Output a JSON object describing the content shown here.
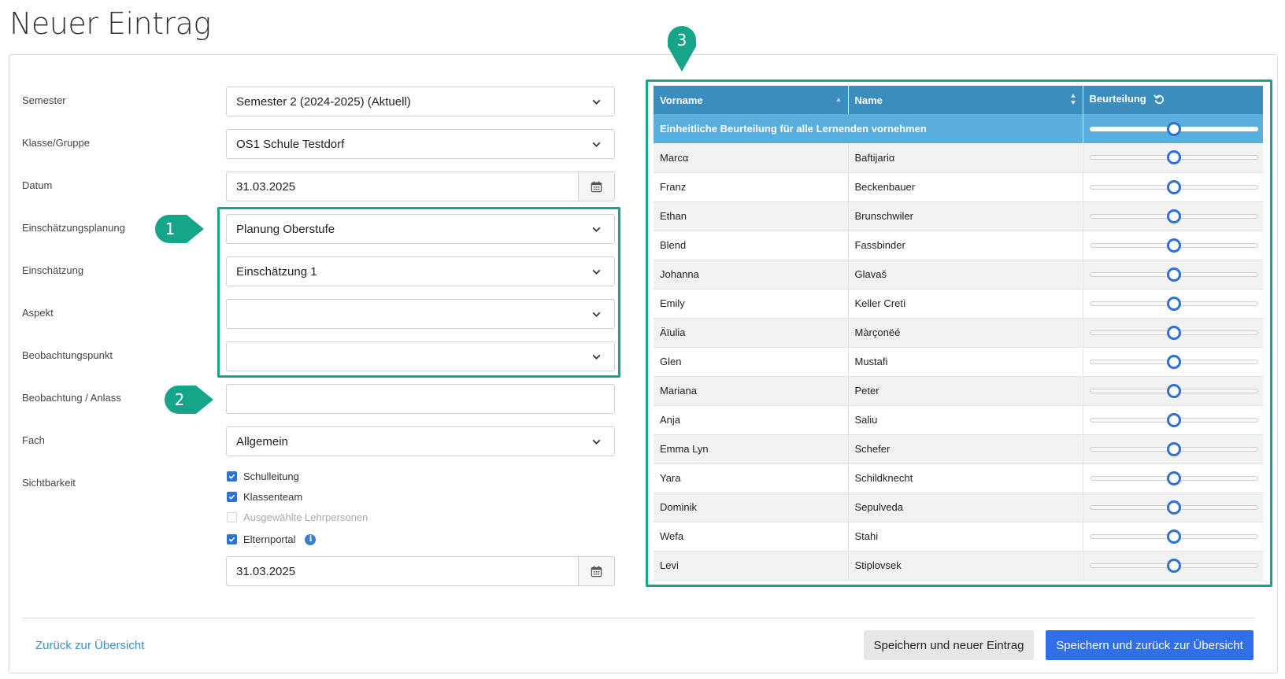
{
  "page": {
    "title": "Neuer Eintrag"
  },
  "form": {
    "semester": {
      "label": "Semester",
      "value": "Semester 2 (2024-2025) (Aktuell)"
    },
    "klasse": {
      "label": "Klasse/Gruppe",
      "value": "OS1 Schule Testdorf"
    },
    "datum": {
      "label": "Datum",
      "value": "31.03.2025"
    },
    "planung": {
      "label": "Einschätzungsplanung",
      "value": "Planung Oberstufe"
    },
    "einschaetzung": {
      "label": "Einschätzung",
      "value": "Einschätzung 1"
    },
    "aspekt": {
      "label": "Aspekt",
      "value": ""
    },
    "beobachtungspunkt": {
      "label": "Beobachtungspunkt",
      "value": ""
    },
    "beobachtung": {
      "label": "Beobachtung / Anlass",
      "value": ""
    },
    "fach": {
      "label": "Fach",
      "value": "Allgemein"
    },
    "sichtbarkeit": {
      "label": "Sichtbarkeit",
      "options": [
        {
          "label": "Schulleitung",
          "checked": true,
          "disabled": false
        },
        {
          "label": "Klassenteam",
          "checked": true,
          "disabled": false
        },
        {
          "label": "Ausgewählte Lehrpersonen",
          "checked": false,
          "disabled": true
        },
        {
          "label": "Elternportal",
          "checked": true,
          "disabled": false
        }
      ],
      "elternportal_date": "31.03.2025"
    }
  },
  "annotations": {
    "badge1": "1",
    "badge2": "2",
    "badge3": "3"
  },
  "table": {
    "headers": {
      "vorname": "Vorname",
      "name": "Name",
      "beurteilung": "Beurteilung"
    },
    "global_row": {
      "label": "Einheitliche Beurteilung für alle Lernenden vornehmen",
      "slider_value": 0.5
    },
    "rows": [
      {
        "vorname": "Marcα",
        "name": "Baftijariα",
        "slider_value": 0.5
      },
      {
        "vorname": "Franz",
        "name": "Beckenbauer",
        "slider_value": 0.5
      },
      {
        "vorname": "Ethan",
        "name": "Brunschwiler",
        "slider_value": 0.5
      },
      {
        "vorname": "Blend",
        "name": "Fassbinder",
        "slider_value": 0.5
      },
      {
        "vorname": "Johanna",
        "name": "Glavaš",
        "slider_value": 0.5
      },
      {
        "vorname": "Emily",
        "name": "Keller Cretì",
        "slider_value": 0.5
      },
      {
        "vorname": "Äïulia",
        "name": "Màrçonëé",
        "slider_value": 0.5
      },
      {
        "vorname": "Glen",
        "name": "Mustafi",
        "slider_value": 0.5
      },
      {
        "vorname": "Mariana",
        "name": "Peter",
        "slider_value": 0.5
      },
      {
        "vorname": "Anja",
        "name": "Saliu",
        "slider_value": 0.5
      },
      {
        "vorname": "Emma Lyn",
        "name": "Schefer",
        "slider_value": 0.5
      },
      {
        "vorname": "Yara",
        "name": "Schildknecht",
        "slider_value": 0.5
      },
      {
        "vorname": "Dominik",
        "name": "Sepulveda",
        "slider_value": 0.5
      },
      {
        "vorname": "Wefa",
        "name": "Stahi",
        "slider_value": 0.5
      },
      {
        "vorname": "Levi",
        "name": "Stiplovsek",
        "slider_value": 0.5
      }
    ]
  },
  "footer": {
    "back_link": "Zurück zur Übersicht",
    "save_new": "Speichern und neuer Eintrag",
    "save_back": "Speichern und zurück zur Übersicht"
  },
  "colors": {
    "accent_green": "#17a589",
    "header_blue": "#3a8dbd",
    "primary_button": "#2f6fe8"
  }
}
